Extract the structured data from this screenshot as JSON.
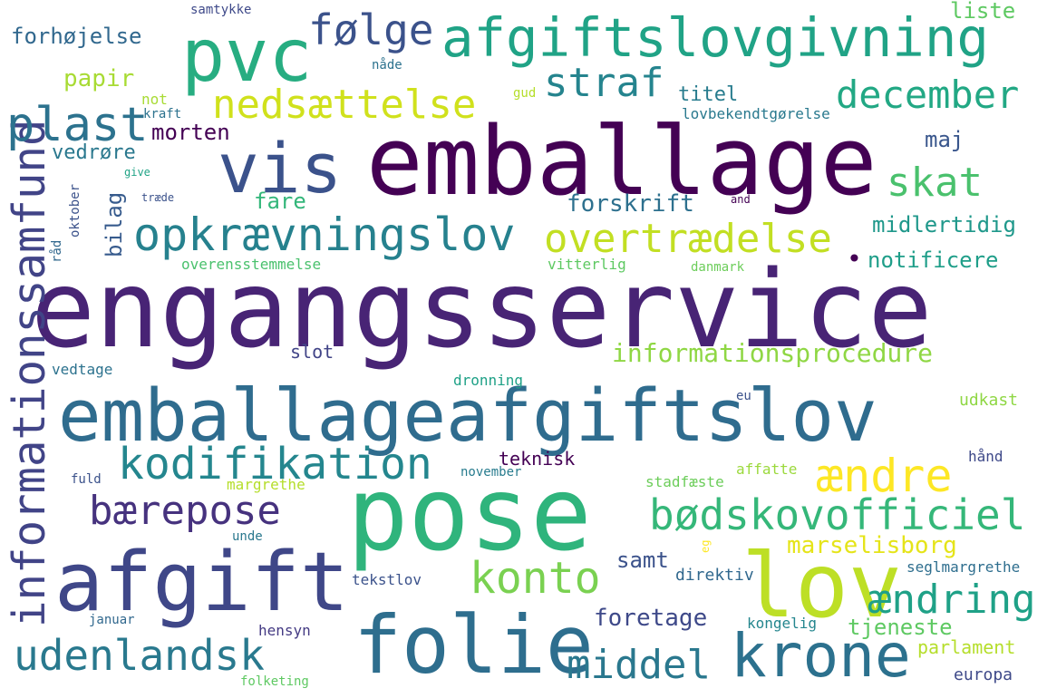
{
  "words": [
    {
      "text": "engangsservice",
      "color": "#482475"
    },
    {
      "text": "emballage",
      "color": "#440154"
    },
    {
      "text": "emballageafgiftslov",
      "color": "#2f6c8e"
    },
    {
      "text": "pose",
      "color": "#2fb47c"
    },
    {
      "text": "afgift",
      "color": "#3f4788"
    },
    {
      "text": "lov",
      "color": "#bddf26"
    },
    {
      "text": "folie",
      "color": "#2e6e8e"
    },
    {
      "text": "vis",
      "color": "#3b528b"
    },
    {
      "text": "pvc",
      "color": "#27ad81"
    },
    {
      "text": "krone",
      "color": "#2c718e"
    },
    {
      "text": "afgiftslovgivning",
      "color": "#20a386"
    },
    {
      "text": "informationssamfund",
      "color": "#414487"
    },
    {
      "text": "opkrævningslov",
      "color": "#26818e"
    },
    {
      "text": "kodifikation",
      "color": "#24868e"
    },
    {
      "text": "bødskovofficiel",
      "color": "#35b779"
    },
    {
      "text": "konto",
      "color": "#7ad151"
    },
    {
      "text": "ændre",
      "color": "#fde725"
    },
    {
      "text": "ændring",
      "color": "#1fa187"
    },
    {
      "text": "udenlandsk",
      "color": "#29798e"
    },
    {
      "text": "følge",
      "color": "#3b528b"
    },
    {
      "text": "bærepose",
      "color": "#46327e"
    },
    {
      "text": "nedsættelse",
      "color": "#d0e11c"
    },
    {
      "text": "overtrædelse",
      "color": "#c2df23"
    },
    {
      "text": "plast",
      "color": "#2c728e"
    },
    {
      "text": "straf",
      "color": "#25848e"
    },
    {
      "text": "december",
      "color": "#22a884"
    },
    {
      "text": "skat",
      "color": "#4ac16d"
    },
    {
      "text": "middel",
      "color": "#2a788e"
    },
    {
      "text": "informationsprocedure",
      "color": "#8fd744"
    },
    {
      "text": "marselisborg",
      "color": "#e5e419"
    },
    {
      "text": "foretage",
      "color": "#3e4989"
    },
    {
      "text": "forskrift",
      "color": "#2d708e"
    },
    {
      "text": "midlertidig",
      "color": "#1f988b"
    },
    {
      "text": "notificere",
      "color": "#1f9e89"
    },
    {
      "text": "samt",
      "color": "#3b528b"
    },
    {
      "text": "tjeneste",
      "color": "#5ec962"
    },
    {
      "text": "morten",
      "color": "#440154"
    },
    {
      "text": "papir",
      "color": "#a8db34"
    },
    {
      "text": "forhøjelse",
      "color": "#31688e"
    },
    {
      "text": "liste",
      "color": "#5ec962"
    },
    {
      "text": "titel",
      "color": "#287c8e"
    },
    {
      "text": "maj",
      "color": "#39568c"
    },
    {
      "text": "vedrøre",
      "color": "#2a788e"
    },
    {
      "text": "bilag",
      "color": "#375b8d"
    },
    {
      "text": "fare",
      "color": "#33b67a"
    },
    {
      "text": "slot",
      "color": "#414487"
    },
    {
      "text": "udkast",
      "color": "#8fd744"
    },
    {
      "text": "teknisk",
      "color": "#440154"
    },
    {
      "text": "parlament",
      "color": "#b5de2b"
    },
    {
      "text": "europa",
      "color": "#3e4989"
    },
    {
      "text": "direktiv",
      "color": "#31688e"
    },
    {
      "text": "kongelig",
      "color": "#24868e"
    },
    {
      "text": "seglmargrethe",
      "color": "#2e6e8e"
    },
    {
      "text": "hensyn",
      "color": "#443a83"
    },
    {
      "text": "tekstlov",
      "color": "#3b528b"
    },
    {
      "text": "januar",
      "color": "#31688e"
    },
    {
      "text": "folketing",
      "color": "#5ec962"
    },
    {
      "text": "unde",
      "color": "#2a788e"
    },
    {
      "text": "margrethe",
      "color": "#b5de2b"
    },
    {
      "text": "stadfæste",
      "color": "#6ccd5a"
    },
    {
      "text": "affatte",
      "color": "#9bd93c"
    },
    {
      "text": "hånd",
      "color": "#3e4989"
    },
    {
      "text": "november",
      "color": "#287c8e"
    },
    {
      "text": "fuld",
      "color": "#3b528b"
    },
    {
      "text": "dronning",
      "color": "#1fa187"
    },
    {
      "text": "eu",
      "color": "#3b528b"
    },
    {
      "text": "vedtage",
      "color": "#2c728e"
    },
    {
      "text": "overensstemmelse",
      "color": "#4ac16d"
    },
    {
      "text": "vitterlig",
      "color": "#5ec962"
    },
    {
      "text": "danmark",
      "color": "#6ccd5a"
    },
    {
      "text": "lovbekendtgørelse",
      "color": "#29798e"
    },
    {
      "text": "kraft",
      "color": "#2c728e"
    },
    {
      "text": "give",
      "color": "#20a386"
    },
    {
      "text": "træde",
      "color": "#3b528b"
    },
    {
      "text": "oktober",
      "color": "#3b528b"
    },
    {
      "text": "råd",
      "color": "#31688e"
    },
    {
      "text": "samtykke",
      "color": "#3e4989"
    },
    {
      "text": "nåde",
      "color": "#2c728e"
    },
    {
      "text": "not",
      "color": "#a8db34"
    },
    {
      "text": "gud",
      "color": "#b5de2b"
    },
    {
      "text": "and",
      "color": "#440154"
    },
    {
      "text": "eg",
      "color": "#fde725"
    },
    {
      "text": "•",
      "color": "#440154"
    }
  ]
}
